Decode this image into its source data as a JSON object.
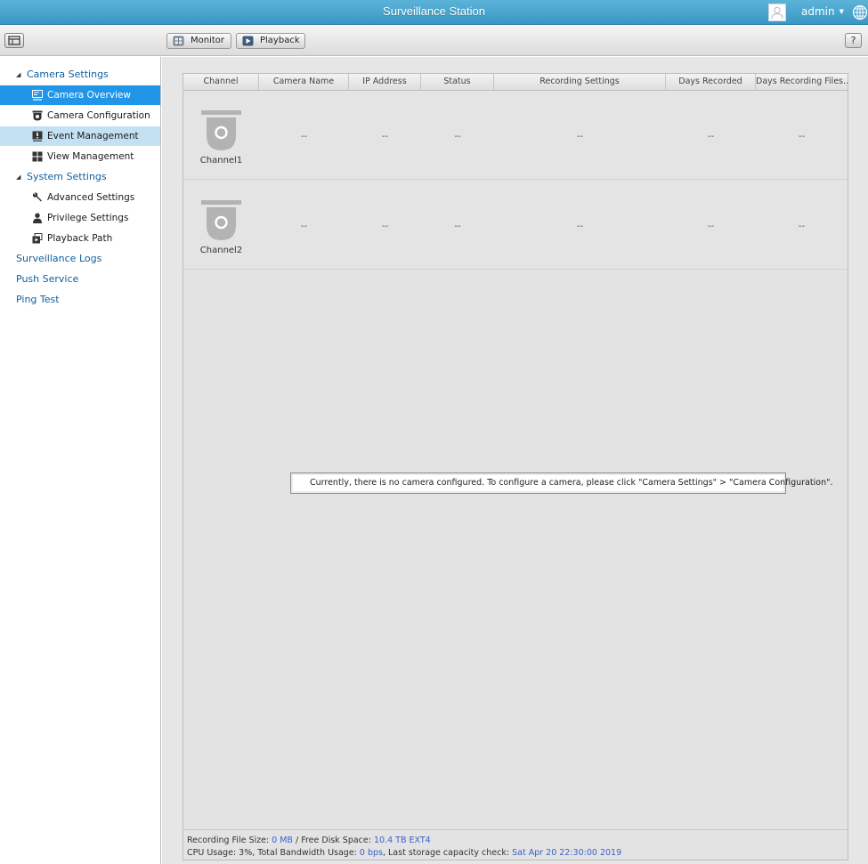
{
  "app": {
    "title": "Surveillance Station",
    "user": "admin",
    "accent_color": "#2196e8",
    "titlebar_color": "#4aa6d0"
  },
  "toolbar": {
    "menu_icon": "window-menu-icon",
    "monitor_label": "Monitor",
    "playback_label": "Playback",
    "help_label": "?"
  },
  "sidebar": {
    "camera_settings": "Camera Settings",
    "camera_overview": "Camera Overview",
    "camera_configuration": "Camera Configuration",
    "event_management": "Event Management",
    "view_management": "View Management",
    "system_settings": "System Settings",
    "advanced_settings": "Advanced Settings",
    "privilege_settings": "Privilege Settings",
    "playback_path": "Playback Path",
    "surveillance_logs": "Surveillance Logs",
    "push_service": "Push Service",
    "ping_test": "Ping Test"
  },
  "table": {
    "headers": [
      "Channel",
      "Camera Name",
      "IP Address",
      "Status",
      "Recording Settings",
      "Days Recorded",
      "Days Recording Files..."
    ],
    "rows": [
      {
        "channel": "Channel1",
        "camera_name": "--",
        "ip": "--",
        "status": "--",
        "recording": "--",
        "days": "--",
        "files": "--"
      },
      {
        "channel": "Channel2",
        "camera_name": "--",
        "ip": "--",
        "status": "--",
        "recording": "--",
        "days": "--",
        "files": "--"
      }
    ]
  },
  "message": "Currently, there is no camera configured. To configure a camera, please click \"Camera Settings\" > \"Camera Configuration\".",
  "footer": {
    "rec_size_label": "Recording File Size: ",
    "rec_size_value": "0 MB",
    "free_label": " / Free Disk Space: ",
    "free_value": "10.4 TB EXT4",
    "cpu_label": "CPU Usage: 3%, Total Bandwidth Usage: ",
    "bandwidth_value": "0 bps",
    "check_label": ", Last storage capacity check: ",
    "check_value": "Sat Apr 20 22:30:00 2019"
  }
}
